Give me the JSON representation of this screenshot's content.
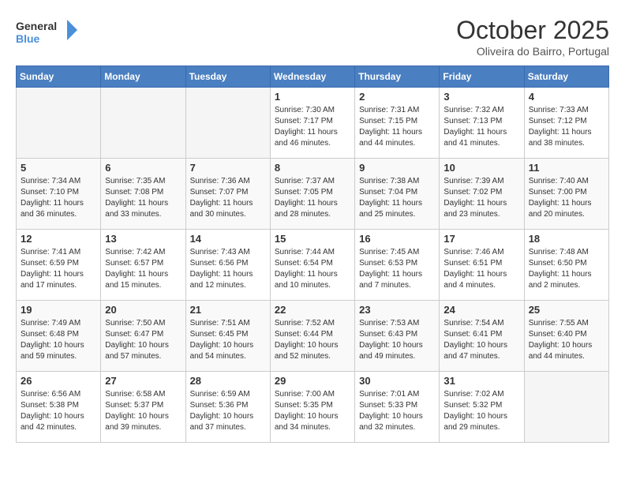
{
  "header": {
    "logo_line1": "General",
    "logo_line2": "Blue",
    "month": "October 2025",
    "location": "Oliveira do Bairro, Portugal"
  },
  "days_of_week": [
    "Sunday",
    "Monday",
    "Tuesday",
    "Wednesday",
    "Thursday",
    "Friday",
    "Saturday"
  ],
  "weeks": [
    [
      {
        "day": "",
        "info": ""
      },
      {
        "day": "",
        "info": ""
      },
      {
        "day": "",
        "info": ""
      },
      {
        "day": "1",
        "info": "Sunrise: 7:30 AM\nSunset: 7:17 PM\nDaylight: 11 hours\nand 46 minutes."
      },
      {
        "day": "2",
        "info": "Sunrise: 7:31 AM\nSunset: 7:15 PM\nDaylight: 11 hours\nand 44 minutes."
      },
      {
        "day": "3",
        "info": "Sunrise: 7:32 AM\nSunset: 7:13 PM\nDaylight: 11 hours\nand 41 minutes."
      },
      {
        "day": "4",
        "info": "Sunrise: 7:33 AM\nSunset: 7:12 PM\nDaylight: 11 hours\nand 38 minutes."
      }
    ],
    [
      {
        "day": "5",
        "info": "Sunrise: 7:34 AM\nSunset: 7:10 PM\nDaylight: 11 hours\nand 36 minutes."
      },
      {
        "day": "6",
        "info": "Sunrise: 7:35 AM\nSunset: 7:08 PM\nDaylight: 11 hours\nand 33 minutes."
      },
      {
        "day": "7",
        "info": "Sunrise: 7:36 AM\nSunset: 7:07 PM\nDaylight: 11 hours\nand 30 minutes."
      },
      {
        "day": "8",
        "info": "Sunrise: 7:37 AM\nSunset: 7:05 PM\nDaylight: 11 hours\nand 28 minutes."
      },
      {
        "day": "9",
        "info": "Sunrise: 7:38 AM\nSunset: 7:04 PM\nDaylight: 11 hours\nand 25 minutes."
      },
      {
        "day": "10",
        "info": "Sunrise: 7:39 AM\nSunset: 7:02 PM\nDaylight: 11 hours\nand 23 minutes."
      },
      {
        "day": "11",
        "info": "Sunrise: 7:40 AM\nSunset: 7:00 PM\nDaylight: 11 hours\nand 20 minutes."
      }
    ],
    [
      {
        "day": "12",
        "info": "Sunrise: 7:41 AM\nSunset: 6:59 PM\nDaylight: 11 hours\nand 17 minutes."
      },
      {
        "day": "13",
        "info": "Sunrise: 7:42 AM\nSunset: 6:57 PM\nDaylight: 11 hours\nand 15 minutes."
      },
      {
        "day": "14",
        "info": "Sunrise: 7:43 AM\nSunset: 6:56 PM\nDaylight: 11 hours\nand 12 minutes."
      },
      {
        "day": "15",
        "info": "Sunrise: 7:44 AM\nSunset: 6:54 PM\nDaylight: 11 hours\nand 10 minutes."
      },
      {
        "day": "16",
        "info": "Sunrise: 7:45 AM\nSunset: 6:53 PM\nDaylight: 11 hours\nand 7 minutes."
      },
      {
        "day": "17",
        "info": "Sunrise: 7:46 AM\nSunset: 6:51 PM\nDaylight: 11 hours\nand 4 minutes."
      },
      {
        "day": "18",
        "info": "Sunrise: 7:48 AM\nSunset: 6:50 PM\nDaylight: 11 hours\nand 2 minutes."
      }
    ],
    [
      {
        "day": "19",
        "info": "Sunrise: 7:49 AM\nSunset: 6:48 PM\nDaylight: 10 hours\nand 59 minutes."
      },
      {
        "day": "20",
        "info": "Sunrise: 7:50 AM\nSunset: 6:47 PM\nDaylight: 10 hours\nand 57 minutes."
      },
      {
        "day": "21",
        "info": "Sunrise: 7:51 AM\nSunset: 6:45 PM\nDaylight: 10 hours\nand 54 minutes."
      },
      {
        "day": "22",
        "info": "Sunrise: 7:52 AM\nSunset: 6:44 PM\nDaylight: 10 hours\nand 52 minutes."
      },
      {
        "day": "23",
        "info": "Sunrise: 7:53 AM\nSunset: 6:43 PM\nDaylight: 10 hours\nand 49 minutes."
      },
      {
        "day": "24",
        "info": "Sunrise: 7:54 AM\nSunset: 6:41 PM\nDaylight: 10 hours\nand 47 minutes."
      },
      {
        "day": "25",
        "info": "Sunrise: 7:55 AM\nSunset: 6:40 PM\nDaylight: 10 hours\nand 44 minutes."
      }
    ],
    [
      {
        "day": "26",
        "info": "Sunrise: 6:56 AM\nSunset: 5:38 PM\nDaylight: 10 hours\nand 42 minutes."
      },
      {
        "day": "27",
        "info": "Sunrise: 6:58 AM\nSunset: 5:37 PM\nDaylight: 10 hours\nand 39 minutes."
      },
      {
        "day": "28",
        "info": "Sunrise: 6:59 AM\nSunset: 5:36 PM\nDaylight: 10 hours\nand 37 minutes."
      },
      {
        "day": "29",
        "info": "Sunrise: 7:00 AM\nSunset: 5:35 PM\nDaylight: 10 hours\nand 34 minutes."
      },
      {
        "day": "30",
        "info": "Sunrise: 7:01 AM\nSunset: 5:33 PM\nDaylight: 10 hours\nand 32 minutes."
      },
      {
        "day": "31",
        "info": "Sunrise: 7:02 AM\nSunset: 5:32 PM\nDaylight: 10 hours\nand 29 minutes."
      },
      {
        "day": "",
        "info": ""
      }
    ]
  ]
}
